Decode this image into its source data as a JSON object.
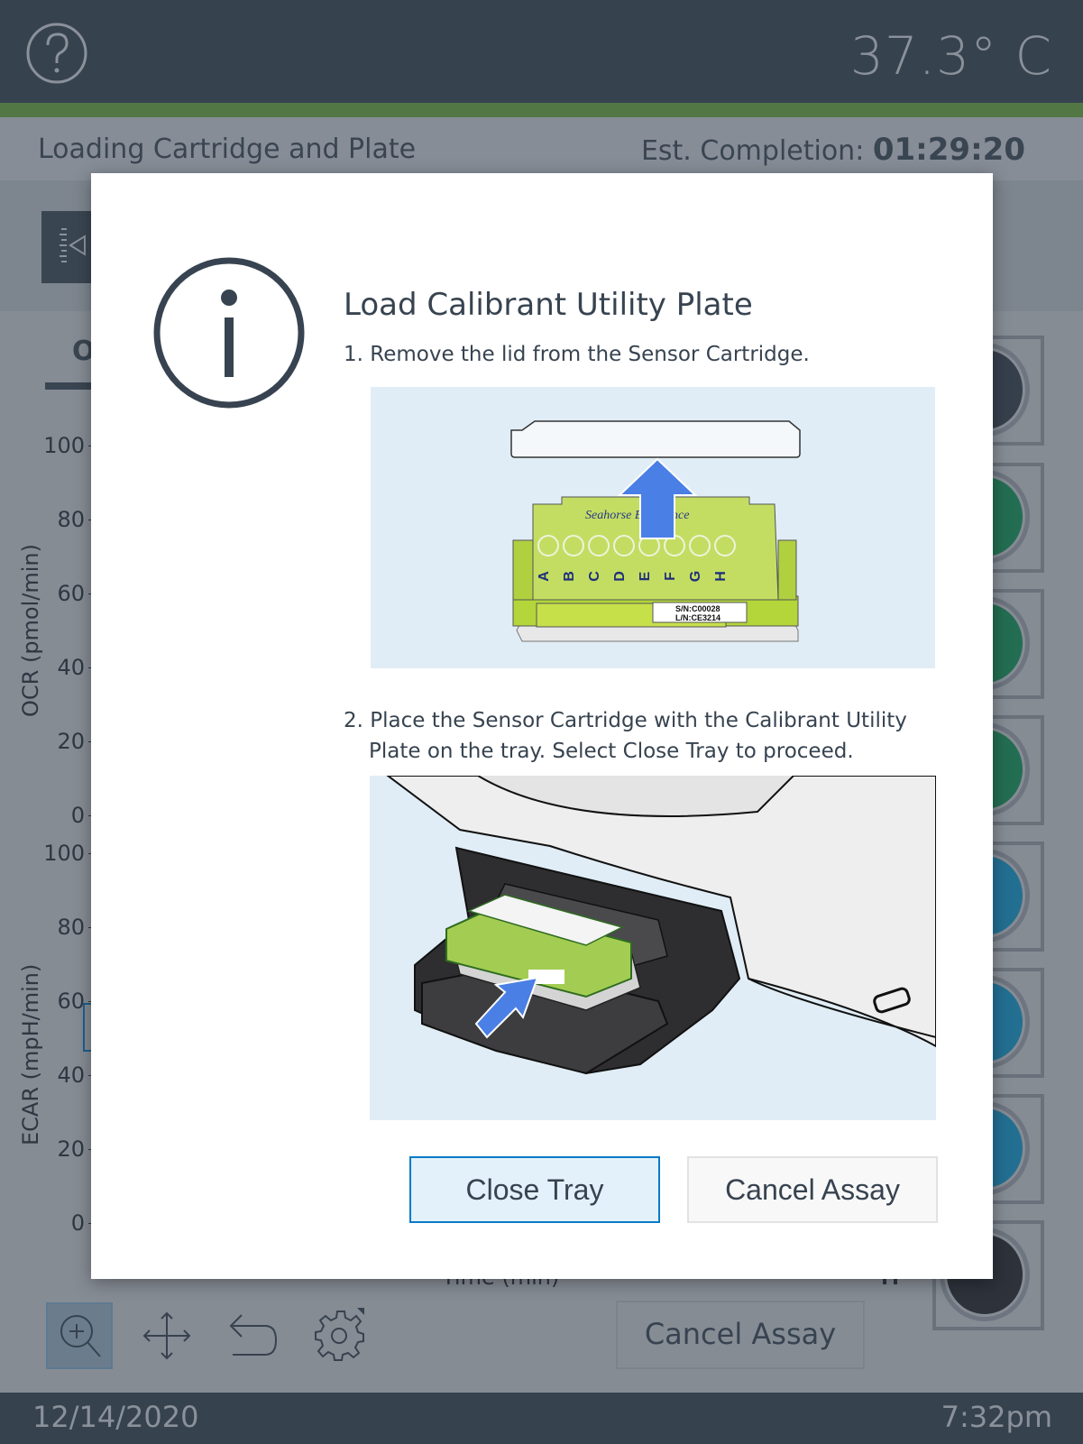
{
  "header": {
    "help_icon": "question-circle-icon",
    "temperature": "37.3° C"
  },
  "status": {
    "title": "Loading Cartridge and Plate",
    "est_label": "Est. Completion:",
    "est_value": "01:29:20"
  },
  "background": {
    "tab_label": "O",
    "ocr_axis": {
      "label": "OCR (pmol/min)",
      "ticks": [
        "100",
        "80",
        "60",
        "40",
        "20",
        "0"
      ]
    },
    "ecar_axis": {
      "label": "ECAR (mpH/min)",
      "ticks": [
        "100",
        "80",
        "60",
        "40",
        "20",
        "0"
      ]
    },
    "xaxis_label": "Time (min)",
    "tools": [
      {
        "name": "zoom-in-icon",
        "active": true
      },
      {
        "name": "move-icon",
        "active": false
      },
      {
        "name": "undo-icon",
        "active": false
      },
      {
        "name": "gear-icon",
        "active": false
      }
    ],
    "cancel_button": "Cancel Assay",
    "wells": [
      {
        "color": "#36404d"
      },
      {
        "color": "#236e52"
      },
      {
        "color": "#236e52"
      },
      {
        "color": "#236e52"
      },
      {
        "color": "#236f92"
      },
      {
        "color": "#236f92"
      },
      {
        "color": "#236f92"
      },
      {
        "color": "#2d323b"
      }
    ]
  },
  "dialog": {
    "icon": "info-circle-icon",
    "title": "Load Calibrant Utility Plate",
    "step1": "1. Remove the lid from the Sensor Cartridge.",
    "step2_line1": "2. Place the Sensor Cartridge with the Calibrant Utility",
    "step2_line2": "Plate on the tray. Select Close Tray to proceed.",
    "image1": {
      "brand_text": "Seahorse Bioscience",
      "column_letters": [
        "A",
        "B",
        "C",
        "D",
        "E",
        "F",
        "G",
        "H"
      ],
      "serial": "S/N:C00028",
      "lot": "L/N:CE3214"
    },
    "close_button": "Close Tray",
    "cancel_button": "Cancel Assay"
  },
  "footer": {
    "date": "12/14/2020",
    "time": "7:32pm"
  }
}
